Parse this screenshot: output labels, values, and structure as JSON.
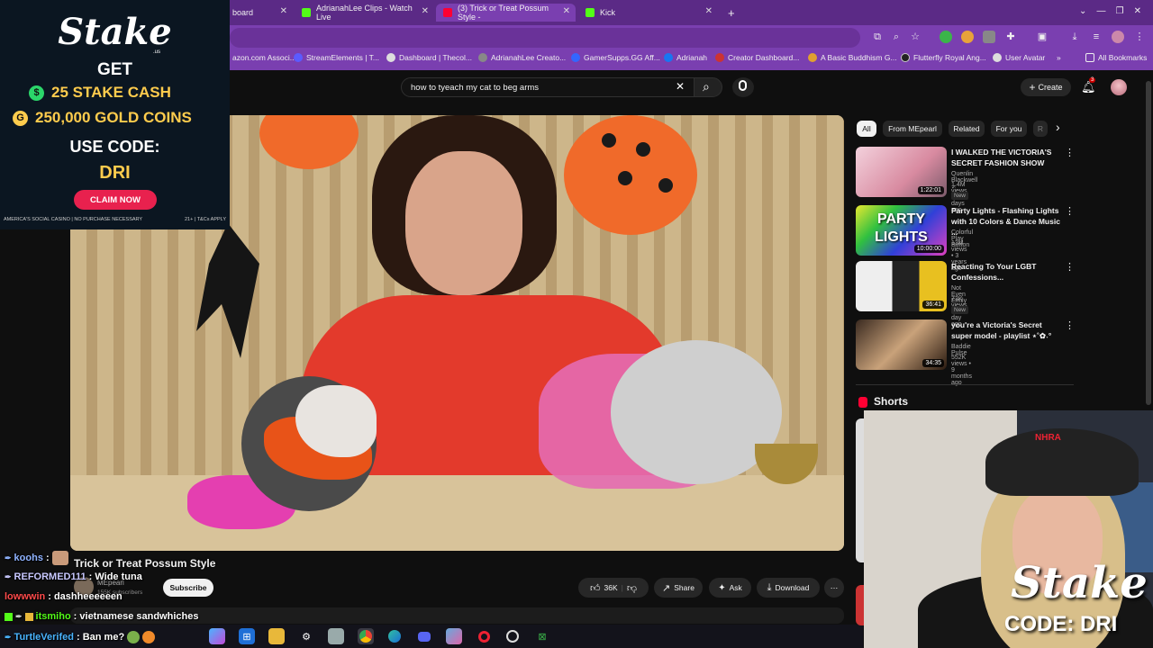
{
  "browser": {
    "tabs": [
      {
        "label": "board",
        "color": "#ffffff"
      },
      {
        "label": "AdrianahLee Clips - Watch Live",
        "color": "#53fc18"
      },
      {
        "label": "(3) Trick or Treat Possum Style -",
        "color": "#ff0033"
      },
      {
        "label": "Kick",
        "color": "#53fc18"
      }
    ],
    "new_tab": "+",
    "bookmarks": [
      {
        "label": "azon.com Associ...",
        "color": "#ff9900"
      },
      {
        "label": "StreamElements | T...",
        "color": "#5b5bff"
      },
      {
        "label": "Dashboard | Thecol...",
        "color": "#dddddd"
      },
      {
        "label": "AdrianahLee Creato...",
        "color": "#888888"
      },
      {
        "label": "GamerSupps.GG Aff...",
        "color": "#3366ff"
      },
      {
        "label": "Adrianah",
        "color": "#1877f2"
      },
      {
        "label": "Creator Dashboard...",
        "color": "#cc3333"
      },
      {
        "label": "A Basic Buddhism G...",
        "color": "#e0a030"
      },
      {
        "label": "Flutterfly Royal Ang...",
        "color": "#222222"
      },
      {
        "label": "User Avatar",
        "color": "#dddddd"
      }
    ],
    "bookmarks_more": "»",
    "all_bookmarks": "All Bookmarks"
  },
  "youtube": {
    "search_query": "how to tyeach my cat to beg arms",
    "create_label": "Create",
    "notification_count": "3",
    "video": {
      "title": "Trick or Treat Possum Style",
      "channel": "MEpearl",
      "subscribers": "155K subscribers",
      "subscribe_label": "Subscribe",
      "likes": "36K",
      "share_label": "Share",
      "ask_label": "Ask",
      "download_label": "Download"
    },
    "chips": [
      {
        "label": "All",
        "active": true
      },
      {
        "label": "From MEpearl",
        "active": false
      },
      {
        "label": "Related",
        "active": false
      },
      {
        "label": "For you",
        "active": false
      },
      {
        "label": "R",
        "active": false
      }
    ],
    "recommendations": [
      {
        "title": "I WALKED THE VICTORIA'S SECRET FASHION SHOW",
        "channel": "Quenlin Blackwell ✓",
        "meta": "1.4M views • 6 days ago",
        "duration": "1:22:01",
        "badge": "New",
        "thumb_color": "#d88aa0"
      },
      {
        "title": "Party Lights - Flashing Lights with 10 Colors & Dance Music ...",
        "channel": "Colorful Play Button",
        "meta": "13M views • 3 years ago",
        "duration": "10:00:00",
        "badge": "",
        "thumb_text": "PARTY LIGHTS",
        "thumb_color": "#3040d8"
      },
      {
        "title": "Reacting To Your LGBT Confessions...",
        "channel": "Not Even Emily ✓",
        "meta": "73K views • 1 day ago",
        "duration": "36:41",
        "badge": "New",
        "thumb_color": "#f0f0f0"
      },
      {
        "title": "you're a Victoria's Secret super model - playlist ⋆˚✿˖°",
        "channel": "Baddie Pulse",
        "meta": "552K views • 9 months ago",
        "duration": "34:35",
        "badge": "",
        "thumb_color": "#c9a27a"
      }
    ],
    "shorts_label": "Shorts"
  },
  "chat": [
    {
      "user": "koohs",
      "text": ":",
      "color": "#8fb3ff"
    },
    {
      "user": "REFORMED111",
      "text": ": Wide tuna",
      "color": "#c8c8ff"
    },
    {
      "user": "lowwwin",
      "text": ": dashheeeeeen",
      "color": "#ff4b4b"
    },
    {
      "user": "itsmiho",
      "text": ": vietnamese sandwhiches",
      "color": "#53fc18"
    },
    {
      "user": "TurtleVerifed",
      "text": ": Ban me?",
      "color": "#4ab4ff"
    }
  ],
  "stake_ad": {
    "logo": "Stake",
    "logo_sub": ".us",
    "get": "GET",
    "offer1": "25 STAKE CASH",
    "offer2": "250,000 GOLD COINS",
    "use_code": "USE CODE:",
    "code": "DRI",
    "claim": "CLAIM NOW",
    "fine_left": "AMERICA'S SOCIAL CASINO | NO PURCHASE NECESSARY",
    "fine_right": "21+ | T&Cs APPLY"
  },
  "webcam_overlay": {
    "logo": "Stake",
    "code": "CODE: DRI",
    "cap_text": "NHRA"
  },
  "icons": {
    "search": "⌕",
    "close": "✕",
    "mic": "🎤",
    "bell": "🔔",
    "kebab": "⋮",
    "like": "👍",
    "dislike": "👎",
    "share": "↗",
    "ask": "✦",
    "download": "⤓",
    "more": "⋯",
    "next": "›"
  }
}
